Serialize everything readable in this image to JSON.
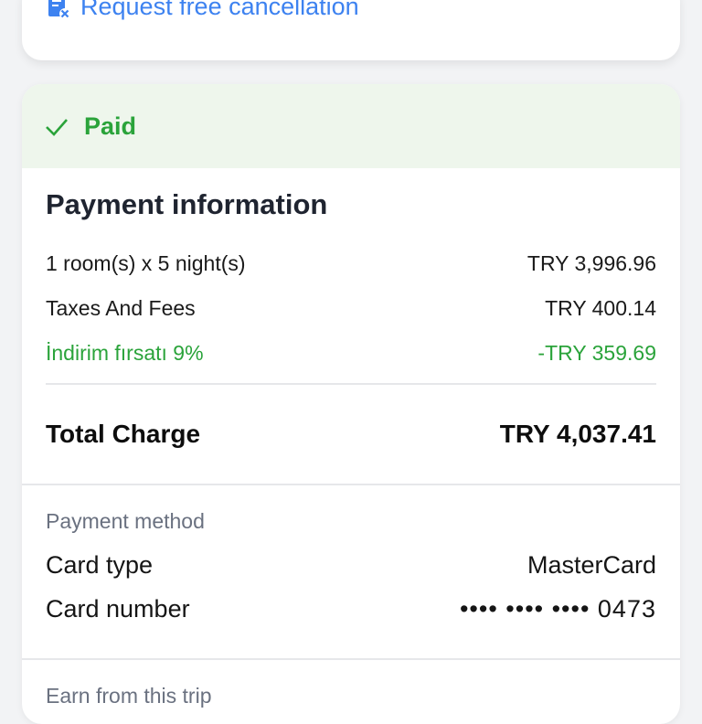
{
  "cancellation": {
    "label": "Request free cancellation",
    "color": "#3d82f0"
  },
  "status": {
    "label": "Paid",
    "color": "#2aa33a"
  },
  "payment_info": {
    "title": "Payment information",
    "lines": [
      {
        "label": "1 room(s) x 5 night(s)",
        "value": "TRY 3,996.96"
      },
      {
        "label": "Taxes And Fees",
        "value": "TRY 400.14"
      },
      {
        "label": "İndirim fırsatı 9%",
        "value": "-TRY 359.69"
      }
    ],
    "total": {
      "label": "Total Charge",
      "value": "TRY 4,037.41"
    }
  },
  "payment_method": {
    "title": "Payment method",
    "card_type": {
      "label": "Card type",
      "value": "MasterCard"
    },
    "card_number": {
      "label": "Card number",
      "value": "•••• •••• •••• 0473"
    }
  },
  "earn": {
    "title": "Earn from this trip"
  }
}
